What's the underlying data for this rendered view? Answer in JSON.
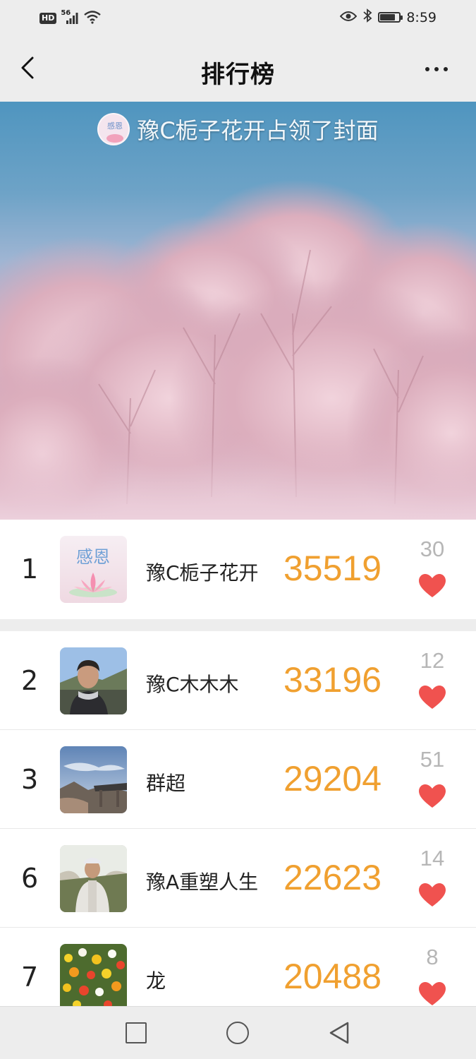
{
  "status_bar": {
    "hd": "HD",
    "network": "56",
    "time": "8:59"
  },
  "nav": {
    "title": "排行榜"
  },
  "cover": {
    "owner_text": "豫C栀子花开占领了封面",
    "avatar_text": "感恩"
  },
  "ranking": [
    {
      "rank": "1",
      "name": "豫C栀子花开",
      "score": "35519",
      "likes": "30",
      "avatar": "lotus",
      "avatar_text": "感恩"
    },
    {
      "rank": "2",
      "name": "豫C木木木",
      "score": "33196",
      "likes": "12",
      "avatar": "person-portrait"
    },
    {
      "rank": "3",
      "name": "群超",
      "score": "29204",
      "likes": "51",
      "avatar": "landscape-sky"
    },
    {
      "rank": "6",
      "name": "豫A重塑人生",
      "score": "22623",
      "likes": "14",
      "avatar": "person-outdoor"
    },
    {
      "rank": "7",
      "name": "龙",
      "score": "20488",
      "likes": "8",
      "avatar": "flowers"
    }
  ],
  "colors": {
    "score": "#f0a030",
    "heart": "#f0524f",
    "likes": "#b6b6b6",
    "background": "#ededed"
  },
  "icons": {
    "back": "chevron-left-icon",
    "more": "more-dots-icon",
    "like": "heart-icon",
    "wifi": "wifi-icon",
    "eye": "eye-icon",
    "bluetooth": "bluetooth-icon",
    "battery": "battery-icon"
  }
}
